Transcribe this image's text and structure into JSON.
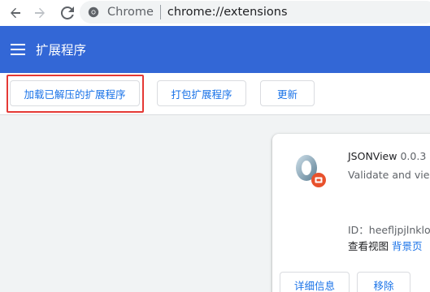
{
  "browser": {
    "site_label": "Chrome",
    "url": "chrome://extensions"
  },
  "header": {
    "title": "扩展程序"
  },
  "toolbar": {
    "load_unpacked_label": "加载已解压的扩展程序",
    "pack_label": "打包扩展程序",
    "update_label": "更新"
  },
  "extension": {
    "name": "JSONView",
    "version": "0.0.3",
    "description": "Validate and view",
    "id_label": "ID：heefljpjlnkloe",
    "views_label": "查看视图",
    "views_link": "背景页",
    "details_label": "详细信息",
    "remove_label": "移除"
  },
  "colors": {
    "header_bg": "#3367d6",
    "accent": "#1a73e8",
    "highlight": "#e53935",
    "icon_badge": "#e8512c"
  }
}
